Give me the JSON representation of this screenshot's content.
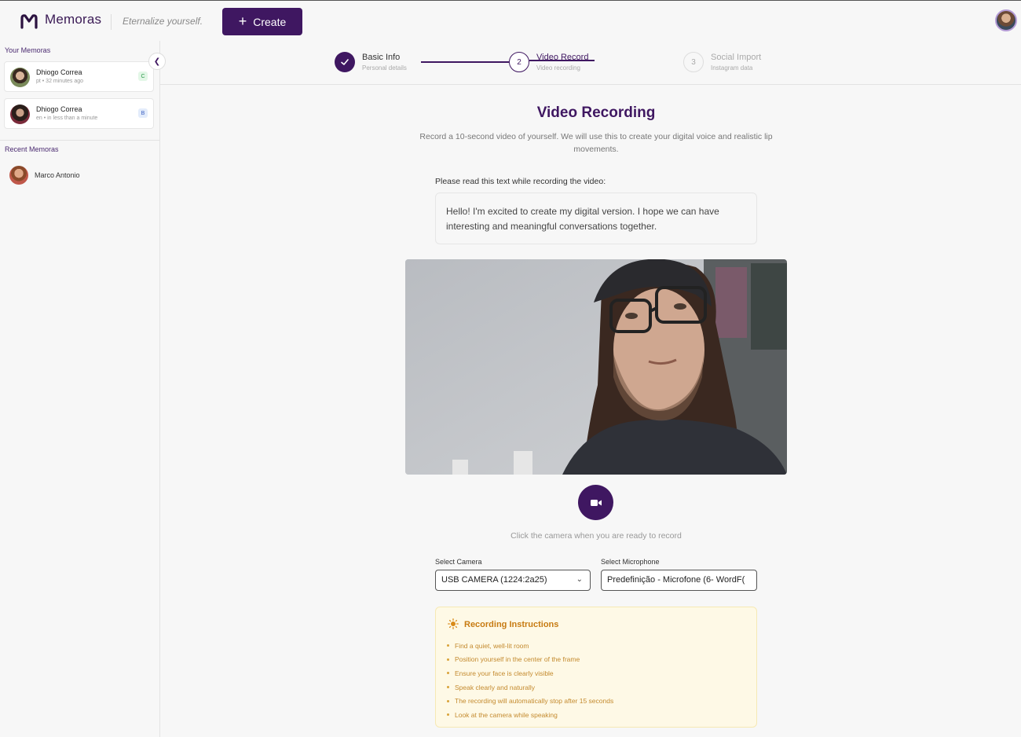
{
  "header": {
    "brand": "Memoras",
    "tagline": "Eternalize yourself.",
    "create_label": "Create"
  },
  "sidebar": {
    "your_title": "Your Memoras",
    "memoras": [
      {
        "name": "Dhiogo Correa",
        "meta": "pt • 32 minutes ago",
        "badge": "C"
      },
      {
        "name": "Dhiogo Correa",
        "meta": "en • in less than a minute",
        "badge": "B"
      }
    ],
    "recent_title": "Recent Memoras",
    "recent": [
      {
        "name": "Marco Antonio"
      }
    ]
  },
  "stepper": {
    "steps": [
      {
        "num": "1",
        "label": "Basic Info",
        "sub": "Personal details",
        "state": "done"
      },
      {
        "num": "2",
        "label": "Video Record",
        "sub": "Video recording",
        "state": "active"
      },
      {
        "num": "3",
        "label": "Social Import",
        "sub": "Instagram data",
        "state": "pending"
      }
    ]
  },
  "main": {
    "title": "Video Recording",
    "lead": "Record a 10-second video of yourself. We will use this to create your digital voice and realistic lip movements.",
    "read_label": "Please read this text while recording the video:",
    "read_text": "Hello! I'm excited to create my digital version. I hope we can have interesting and meaningful conversations together.",
    "record_hint": "Click the camera when you are ready to record",
    "camera_label": "Select Camera",
    "camera_value": "USB CAMERA (1224:2a25)",
    "mic_label": "Select Microphone",
    "mic_value": "Predefinição - Microfone (6- WordF("
  },
  "instructions": {
    "title": "Recording Instructions",
    "items": [
      "Find a quiet, well-lit room",
      "Position yourself in the center of the frame",
      "Ensure your face is clearly visible",
      "Speak clearly and naturally",
      "The recording will automatically stop after 15 seconds",
      "Look at the camera while speaking"
    ]
  },
  "colors": {
    "brand": "#3f1761",
    "instruction_accent": "#c77b12"
  }
}
